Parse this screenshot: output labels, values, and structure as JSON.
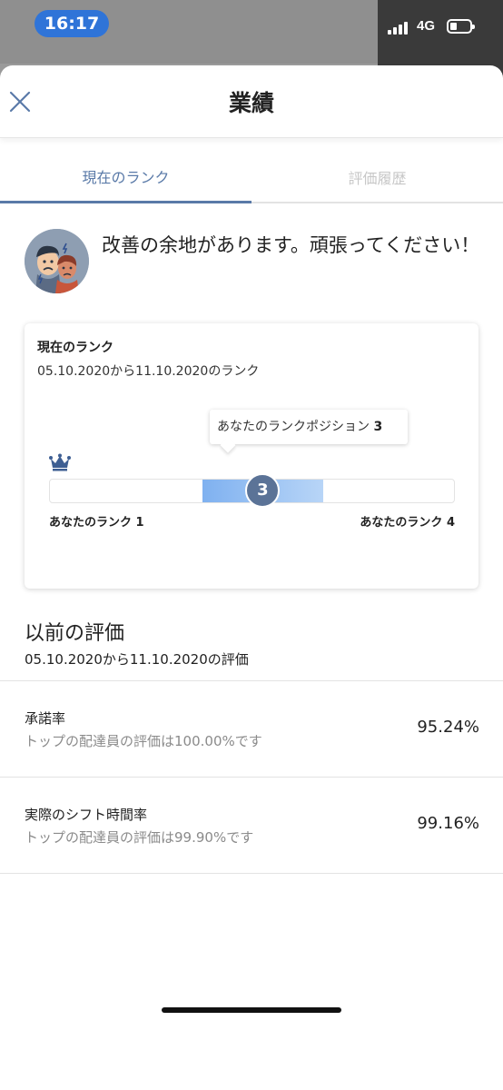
{
  "status_bar": {
    "time": "16:17",
    "network": "4G",
    "battery_level": 0.35
  },
  "header": {
    "title": "業績"
  },
  "tabs": [
    {
      "label": "現在のランク",
      "active": true
    },
    {
      "label": "評価履歴",
      "active": false
    }
  ],
  "message": {
    "text": "改善の余地があります。頑張ってください！"
  },
  "rank_card": {
    "title": "現在のランク",
    "period": "05.10.2020から11.10.2020のランク",
    "tooltip_label": "あなたのランクポジション",
    "position": "3",
    "min_label": "あなたのランク 1",
    "max_label": "あなたのランク 4",
    "rank_count": 4,
    "current_rank": 3
  },
  "previous": {
    "title": "以前の評価",
    "period": "05.10.2020から11.10.2020の評価"
  },
  "metrics": [
    {
      "name": "承諾率",
      "description": "トップの配達員の評価は100.00%です",
      "value": "95.24%"
    },
    {
      "name": "実際のシフト時間率",
      "description": "トップの配達員の評価は99.90%です",
      "value": "99.16%"
    }
  ],
  "colors": {
    "accent": "#5a7aa8",
    "marker": "#5b7397",
    "bar": "#7fb1f0",
    "time_pill": "#2f74d8"
  }
}
